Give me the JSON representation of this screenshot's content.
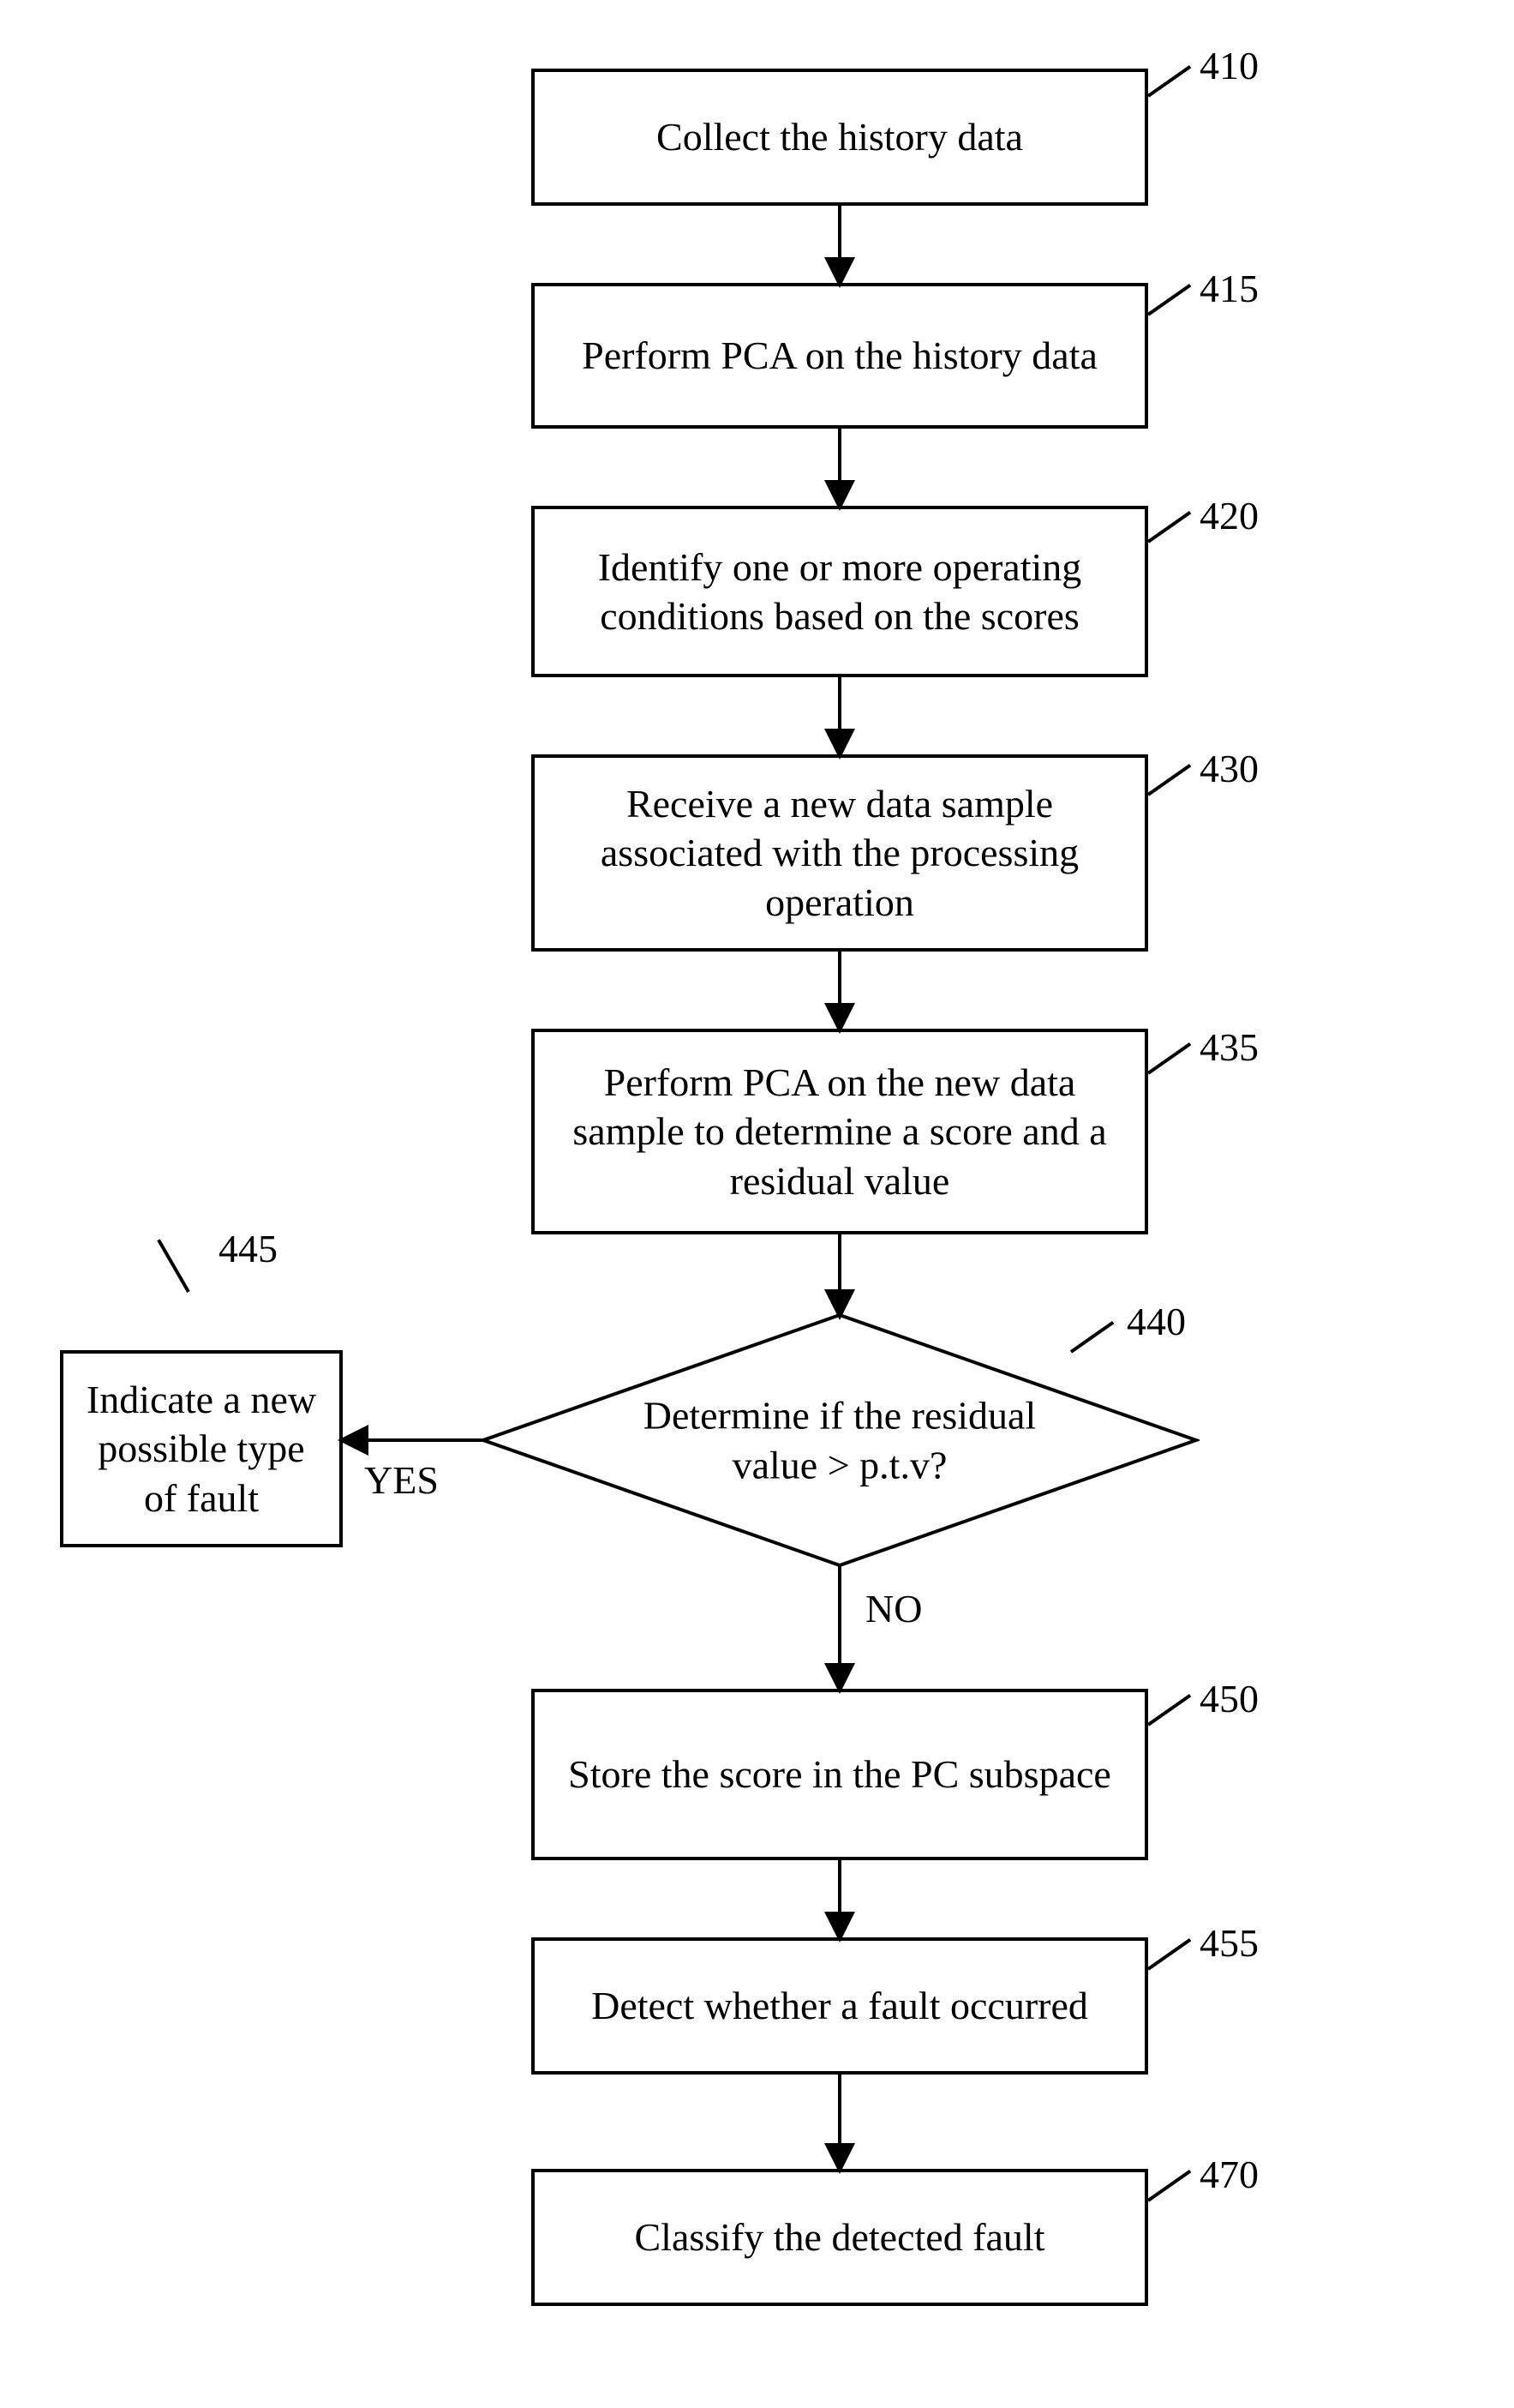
{
  "nodes": {
    "n410": {
      "text": "Collect the history data",
      "ref": "410"
    },
    "n415": {
      "text": "Perform PCA on the history data",
      "ref": "415"
    },
    "n420": {
      "text": "Identify one or more operating conditions based on the scores",
      "ref": "420"
    },
    "n430": {
      "text": "Receive a new data sample associated with the processing operation",
      "ref": "430"
    },
    "n435": {
      "text": "Perform PCA on the new data sample to determine a score and a residual value",
      "ref": "435"
    },
    "n440": {
      "text": "Determine if the residual value > p.t.v?",
      "ref": "440"
    },
    "n445": {
      "text": "Indicate a new possible type of fault",
      "ref": "445"
    },
    "n450": {
      "text": "Store the score in the PC subspace",
      "ref": "450"
    },
    "n455": {
      "text": "Detect whether a fault occurred",
      "ref": "455"
    },
    "n470": {
      "text": "Classify the detected fault",
      "ref": "470"
    }
  },
  "edge_labels": {
    "yes": "YES",
    "no": "NO"
  }
}
